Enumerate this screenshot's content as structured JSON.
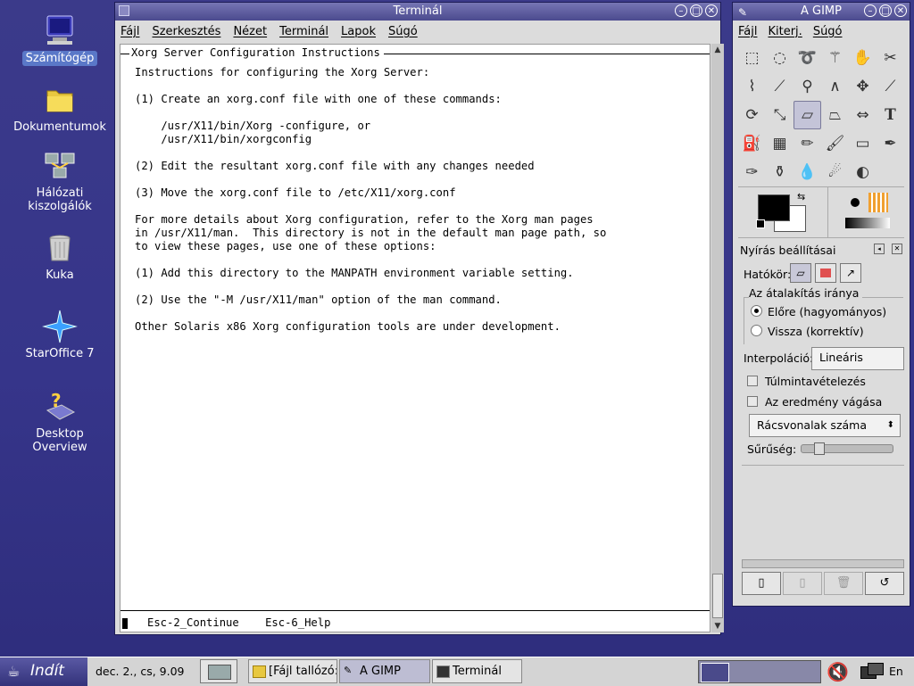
{
  "desktop": {
    "icons": [
      {
        "label": "Számítógép"
      },
      {
        "label": "Dokumentumok"
      },
      {
        "label": "Hálózati kiszolgálók"
      },
      {
        "label": "Kuka"
      },
      {
        "label": "StarOffice 7"
      },
      {
        "label": "Desktop Overview"
      }
    ]
  },
  "terminal": {
    "title": "Terminál",
    "menu": [
      "Fájl",
      "Szerkesztés",
      "Nézet",
      "Terminál",
      "Lapok",
      "Súgó"
    ],
    "header": "Xorg Server Configuration Instructions",
    "body": "Instructions for configuring the Xorg Server:\n\n(1) Create an xorg.conf file with one of these commands:\n\n    /usr/X11/bin/Xorg -configure, or\n    /usr/X11/bin/xorgconfig\n\n(2) Edit the resultant xorg.conf file with any changes needed\n\n(3) Move the xorg.conf file to /etc/X11/xorg.conf\n\nFor more details about Xorg configuration, refer to the Xorg man pages\nin /usr/X11/man.  This directory is not in the default man page path, so\nto view these pages, use one of these options:\n\n(1) Add this directory to the MANPATH environment variable setting.\n\n(2) Use the \"-M /usr/X11/man\" option of the man command.\n\nOther Solaris x86 Xorg configuration tools are under development.",
    "footer": "Esc-2_Continue    Esc-6_Help"
  },
  "gimp": {
    "title": "A GIMP",
    "menu": [
      "Fájl",
      "Kiterj.",
      "Súgó"
    ],
    "panel_title": "Nyírás beállításai",
    "scope_label": "Hatókör:",
    "direction_label": "Az átalakítás iránya",
    "direction_options": [
      "Előre (hagyományos)",
      "Vissza (korrektív)"
    ],
    "interpolation_label": "Interpoláció:",
    "interpolation_value": "Lineáris",
    "supersampling": "Túlmintavételezés",
    "clip_result": "Az eredmény vágása",
    "grid_mode": "Rácsvonalak száma",
    "density_label": "Sűrűség:"
  },
  "taskbar": {
    "start": "Indít",
    "clock": "dec. 2., cs,  9.09",
    "tasks": [
      "[Fájl tallózó: /",
      "A GIMP",
      "Terminál"
    ],
    "lang": "En"
  },
  "colors": {
    "desktop": "#36358a",
    "titlebar": "#5a59a0",
    "selection": "#5a78c8"
  }
}
